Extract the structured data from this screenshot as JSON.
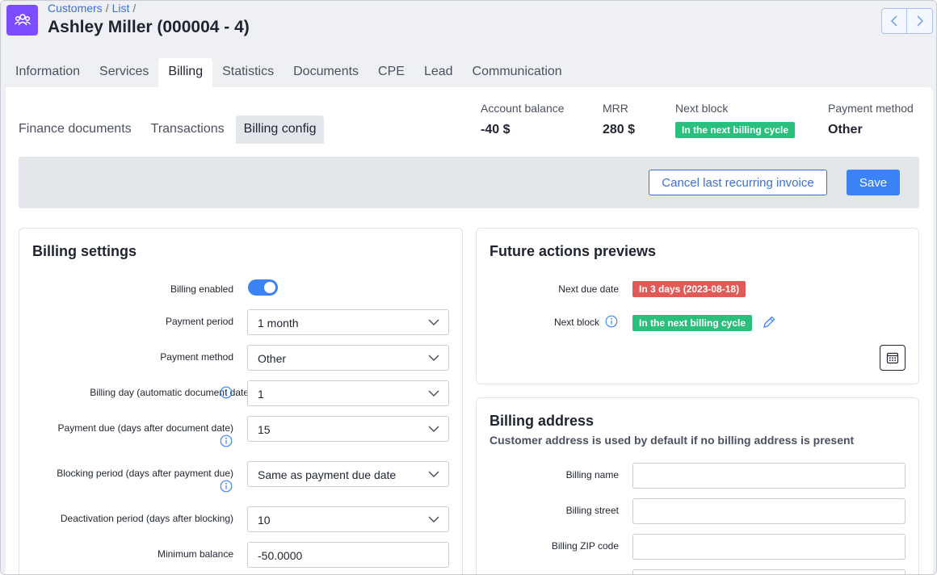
{
  "breadcrumb": {
    "item1": "Customers",
    "item2": "List",
    "separator": "/"
  },
  "header": {
    "title": "Ashley Miller (000004 - 4)"
  },
  "main_tabs": [
    {
      "label": "Information"
    },
    {
      "label": "Services"
    },
    {
      "label": "Billing",
      "active": true
    },
    {
      "label": "Statistics"
    },
    {
      "label": "Documents"
    },
    {
      "label": "CPE"
    },
    {
      "label": "Lead"
    },
    {
      "label": "Communication"
    }
  ],
  "sub_tabs": [
    {
      "label": "Finance documents"
    },
    {
      "label": "Transactions"
    },
    {
      "label": "Billing config",
      "active": true
    }
  ],
  "summary": {
    "account_balance_label": "Account balance",
    "account_balance_value": "-40 $",
    "mrr_label": "MRR",
    "mrr_value": "280 $",
    "next_block_label": "Next block",
    "next_block_value": "In the next billing cycle",
    "payment_method_label": "Payment method",
    "payment_method_value": "Other"
  },
  "actions": {
    "cancel_label": "Cancel last recurring invoice",
    "save_label": "Save"
  },
  "billing_settings": {
    "title": "Billing settings",
    "billing_enabled_label": "Billing enabled",
    "billing_enabled": true,
    "payment_period_label": "Payment period",
    "payment_period_value": "1 month",
    "payment_method_label": "Payment method",
    "payment_method_value": "Other",
    "billing_day_label": "Billing day (automatic document date)",
    "billing_day_value": "1",
    "payment_due_label": "Payment due (days after document date)",
    "payment_due_value": "15",
    "blocking_period_label": "Blocking period (days after payment due)",
    "blocking_period_value": "Same as payment due date",
    "deactivation_period_label": "Deactivation period (days after blocking)",
    "deactivation_period_value": "10",
    "minimum_balance_label": "Minimum balance",
    "minimum_balance_value": "-50.0000"
  },
  "future_actions": {
    "title": "Future actions previews",
    "next_due_date_label": "Next due date",
    "next_due_date_value": "In 3 days (2023-08-18)",
    "next_block_label": "Next block",
    "next_block_value": "In the next billing cycle"
  },
  "billing_address": {
    "title": "Billing address",
    "subtitle": "Customer address is used by default if no billing address is present",
    "billing_name_label": "Billing name",
    "billing_street_label": "Billing street",
    "billing_zip_label": "Billing ZIP code",
    "billing_name_value": "",
    "billing_street_value": "",
    "billing_zip_value": ""
  },
  "colors": {
    "accent": "#3b82f6",
    "app_icon": "#7c4dff",
    "success_badge": "#2bbf7e",
    "danger_badge": "#e05a57",
    "link": "#3b6fd8"
  },
  "icons": {
    "app": "customers-group-icon",
    "prev": "chevron-left-icon",
    "next": "chevron-right-icon",
    "select": "chevron-down-icon",
    "info": "info-icon",
    "edit": "pencil-icon",
    "calendar": "calendar-icon"
  }
}
